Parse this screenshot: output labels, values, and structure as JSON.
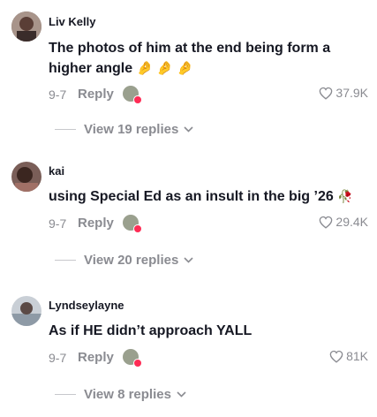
{
  "comments": [
    {
      "username": "Liv Kelly",
      "text_line1": "The photos of him at the end being form a",
      "text_line2": "higher angle",
      "emoji": "🤌 🤌 🤌",
      "date": "9-7",
      "reply_label": "Reply",
      "likes": "37.9K",
      "view_replies": "View 19 replies"
    },
    {
      "username": "kai",
      "text": "using Special Ed as an insult in the big ’26",
      "emoji": "🥀",
      "date": "9-7",
      "reply_label": "Reply",
      "likes": "29.4K",
      "view_replies": "View 20 replies"
    },
    {
      "username": "Lyndseylayne",
      "text": "As if HE didn’t approach YALL",
      "date": "9-7",
      "reply_label": "Reply",
      "likes": "81K",
      "view_replies": "View 8 replies"
    }
  ],
  "icons": {
    "like": "heart-outline-icon",
    "expand": "chevron-down-icon",
    "creator_badge": "creator-liked-avatar"
  },
  "colors": {
    "text_primary": "#161823",
    "text_secondary": "#8a8b91",
    "accent": "#fe2c55"
  }
}
